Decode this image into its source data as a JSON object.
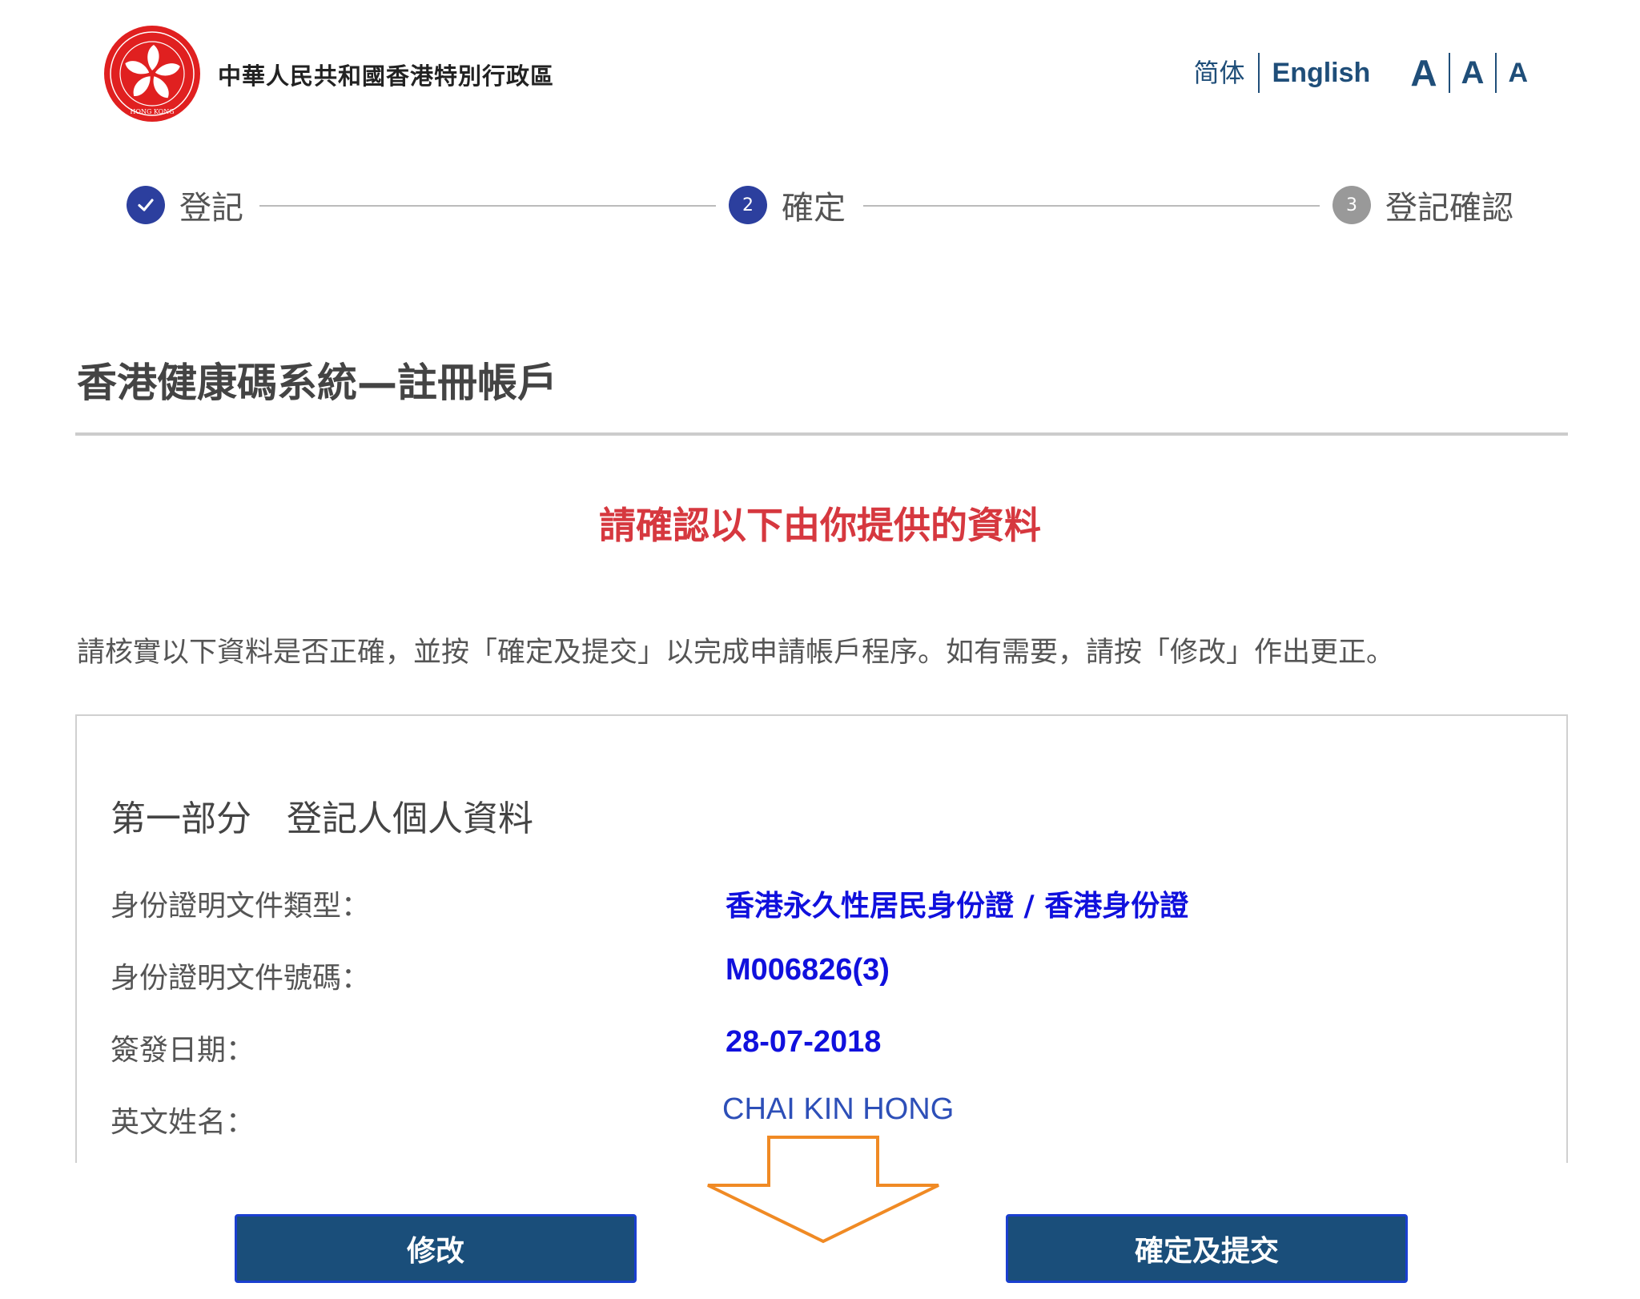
{
  "header": {
    "gov_name": "中華人民共和國香港特別行政區",
    "emblem_ring_text": "HONG KONG",
    "lang_simplified": "简体",
    "lang_english": "English",
    "font_large": "A",
    "font_medium": "A",
    "font_small": "A"
  },
  "stepper": {
    "steps": [
      {
        "number": "1",
        "label": "登記",
        "state": "done"
      },
      {
        "number": "2",
        "label": "確定",
        "state": "active"
      },
      {
        "number": "3",
        "label": "登記確認",
        "state": "todo"
      }
    ]
  },
  "page": {
    "title": "香港健康碼系統—註冊帳戶",
    "confirm_heading": "請確認以下由你提供的資料",
    "instruction": "請核實以下資料是否正確，並按「確定及提交」以完成申請帳戶程序。如有需要，請按「修改」作出更正。"
  },
  "section1": {
    "title": "第一部分　登記人個人資料",
    "rows": [
      {
        "label": "身份證明文件類型：",
        "value": "香港永久性居民身份證 / 香港身份證"
      },
      {
        "label": "身份證明文件號碼：",
        "value": "M006826(3)"
      },
      {
        "label": "簽發日期：",
        "value": "28-07-2018"
      },
      {
        "label": "英文姓名：",
        "value": "CHAI KIN HONG"
      }
    ]
  },
  "buttons": {
    "modify": "修改",
    "submit": "確定及提交"
  },
  "colors": {
    "primary": "#2c3f9e",
    "button_bg": "#1a4e7a",
    "heading_red": "#d6383f",
    "value_blue": "#1010dd",
    "annotation_orange": "#f08a24"
  }
}
